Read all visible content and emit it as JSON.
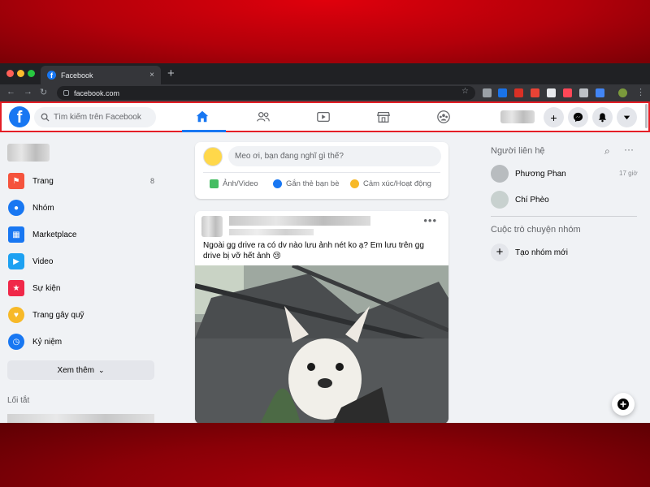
{
  "browser": {
    "tab_title": "Facebook",
    "favicon_letter": "f",
    "url": "facebook.com",
    "new_tab": "+",
    "tab_close": "×"
  },
  "header": {
    "logo_letter": "f",
    "search_placeholder": "Tìm kiếm trên Facebook",
    "nav_icons": [
      "home-icon",
      "friends-icon",
      "watch-icon",
      "marketplace-icon",
      "groups-icon"
    ],
    "active_nav": "home",
    "create_label": "+",
    "accent": "#1877f2",
    "highlight_border": "#e41e26"
  },
  "sidebar": {
    "items": [
      {
        "label": "Trang",
        "count": "8",
        "icon": "flag-icon",
        "color": "#f5533d"
      },
      {
        "label": "Nhóm",
        "icon": "groups-icon",
        "color": "#1877f2"
      },
      {
        "label": "Marketplace",
        "icon": "marketplace-icon",
        "color": "#1877f2"
      },
      {
        "label": "Video",
        "icon": "video-icon",
        "color": "#1da1f2"
      },
      {
        "label": "Sự kiện",
        "icon": "calendar-icon",
        "color": "#f02849"
      },
      {
        "label": "Trang gây quỹ",
        "icon": "heart-icon",
        "color": "#f7b928"
      },
      {
        "label": "Kỷ niệm",
        "icon": "clock-icon",
        "color": "#1877f2"
      }
    ],
    "see_more": "Xem thêm",
    "shortcuts_title": "Lối tắt"
  },
  "composer": {
    "placeholder": "Meo ơi, bạn đang nghĩ gì thế?",
    "actions": [
      {
        "label": "Ảnh/Video",
        "icon": "photo-icon",
        "color": "#45bd62"
      },
      {
        "label": "Gắn thẻ bạn bè",
        "icon": "tag-friends-icon",
        "color": "#1877f2"
      },
      {
        "label": "Cảm xúc/Hoạt động",
        "icon": "feeling-icon",
        "color": "#f7b928"
      }
    ]
  },
  "post": {
    "more": "•••",
    "text": "Ngoài gg drive ra có dv nào lưu ảnh nét ko ạ? Em lưu trên gg drive bị vỡ hết ảnh 😢"
  },
  "contacts": {
    "title": "Người liên hệ",
    "list": [
      {
        "name": "Phương Phan",
        "time": "17 giờ"
      },
      {
        "name": "Chí Phèo",
        "time": ""
      }
    ]
  },
  "group_chats": {
    "title": "Cuộc trò chuyện nhóm",
    "create_label": "Tạo nhóm mới"
  }
}
